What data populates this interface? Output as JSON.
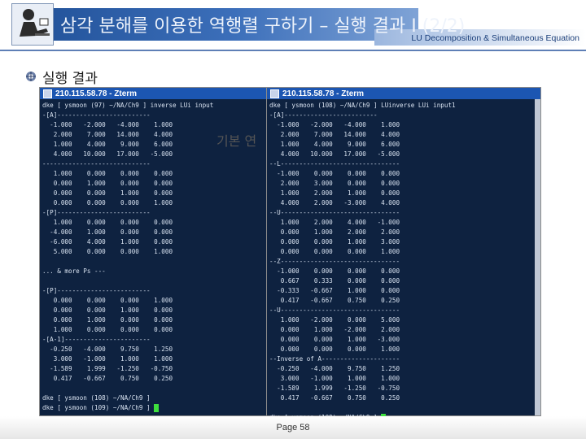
{
  "header": {
    "title": "삼각 분해를 이용한 역행렬 구하기 – 실행 결과 I (2/2)",
    "subtitle": "LU Decomposition & Simultaneous Equation",
    "logo_icon": "person-at-desk-icon"
  },
  "section": {
    "bullet_icon": "bullet-disc-icon",
    "label": "실행 결과"
  },
  "overlay": "기본 연",
  "terminals": {
    "left": {
      "title": "210.115.58.78 - Zterm",
      "lines": [
        "dke [ ysmoon (97) ~/NA/Ch9 ] inverse LUi input",
        "-[A]-------------------------",
        "  -1.000   -2.000   -4.000    1.000",
        "   2.000    7.000   14.000    4.000",
        "   1.000    4.000    9.000    6.000",
        "   4.000   10.000   17.000   -5.000",
        "-----------------------------",
        "   1.000    0.000    0.000    0.000",
        "   0.000    1.000    0.000    0.000",
        "   0.000    0.000    1.000    0.000",
        "   0.000    0.000    0.000    1.000",
        "-[P]-------------------------",
        "   1.000    0.000    0.000    0.000",
        "  -4.000    1.000    0.000    0.000",
        "  -6.000    4.000    1.000    0.000",
        "   5.000    0.000    0.000    1.000",
        "",
        "... & more Ps ---",
        "",
        "-[P]-------------------------",
        "   0.000    0.000    0.000    1.000",
        "   0.000    0.000    1.000    0.000",
        "   0.000    1.000    0.000    0.000",
        "   1.000    0.000    0.000    0.000",
        "-[A-1]-----------------------",
        "  -0.250   -4.000    9.750    1.250",
        "   3.000   -1.000    1.000    1.000",
        "  -1.589    1.999   -1.250   -0.750",
        "   0.417   -0.667    0.750    0.250",
        "",
        "dke [ ysmoon (108) ~/NA/Ch9 ]",
        "dke [ ysmoon (109) ~/NA/Ch9 ] "
      ]
    },
    "right": {
      "title": "210.115.58.78 - Zterm",
      "lines": [
        "dke [ ysmoon (108) ~/NA/Ch9 ] LUinverse LUi input1",
        "-[A]-------------------------",
        "  -1.000   -2.000   -4.000    1.000",
        "   2.000    7.000   14.000    4.000",
        "   1.000    4.000    9.000    6.000",
        "   4.000   10.000   17.000   -5.000",
        "--L--------------------------------",
        "  -1.000    0.000    0.000    0.000",
        "   2.000    3.000    0.000    0.000",
        "   1.000    2.000    1.000    0.000",
        "   4.000    2.000   -3.000    4.000",
        "--U--------------------------------",
        "   1.000    2.000    4.000   -1.000",
        "   0.000    1.000    2.000    2.000",
        "   0.000    0.000    1.000    3.000",
        "   0.000    0.000    0.000    1.000",
        "--Z--------------------------------",
        "  -1.000    0.000    0.000    0.000",
        "   0.667    0.333    0.000    0.000",
        "  -0.333   -0.667    1.000    0.000",
        "   0.417   -0.667    0.750    0.250",
        "--U--------------------------------",
        "   1.000   -2.000    0.000    5.000",
        "   0.000    1.000   -2.000    2.000",
        "   0.000    0.000    1.000   -3.000",
        "   0.000    0.000    0.000    1.000",
        "--Inverse of A---------------------",
        "  -0.250   -4.000    9.750    1.250",
        "   3.000   -1.000    1.000    1.000",
        "  -1.589    1.999   -1.250   -0.750",
        "   0.417   -0.667    0.750    0.250",
        "",
        "dke [ ysmoon (109) ~/NA/Ch9 ] "
      ]
    }
  },
  "footer": {
    "page": "Page 58"
  }
}
